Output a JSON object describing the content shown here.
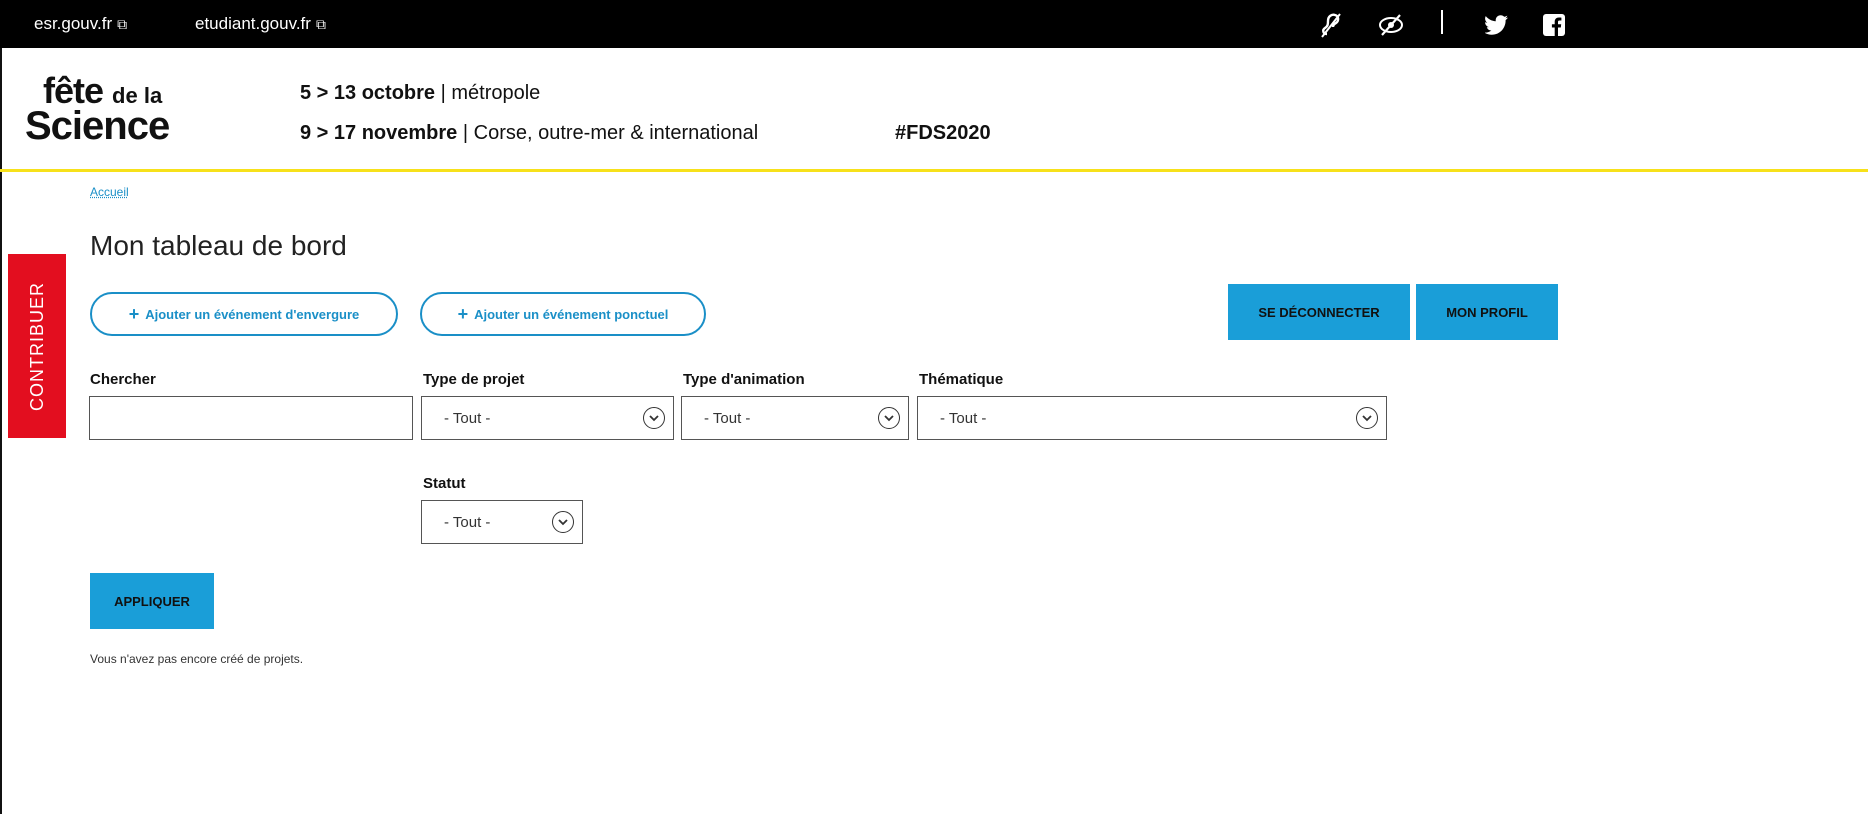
{
  "topbar": {
    "links": [
      "esr.gouv.fr",
      "etudiant.gouv.fr"
    ],
    "icons": [
      "hearing-assist-icon",
      "eye-slash-icon",
      "twitter-icon",
      "facebook-icon"
    ]
  },
  "header": {
    "logo_line1": "fête",
    "logo_line1_small": "de la",
    "logo_line2": "Science",
    "date1_bold": "5 > 13 octobre",
    "date1_rest": " | métropole",
    "date2_bold": "9 > 17 novembre",
    "date2_rest": " | Corse, outre-mer & international",
    "hashtag": "#FDS2020"
  },
  "breadcrumb": "Accueil",
  "page_title": "Mon tableau de bord",
  "side_tab": "CONTRIBUER",
  "actions": {
    "add_major": "Ajouter un événement d'envergure",
    "add_single": "Ajouter un événement ponctuel",
    "logout": "SE DÉCONNECTER",
    "profile": "MON PROFIL"
  },
  "filters": {
    "search_label": "Chercher",
    "search_value": "",
    "project_type_label": "Type de projet",
    "project_type_value": "- Tout -",
    "animation_type_label": "Type d'animation",
    "animation_type_value": "- Tout -",
    "theme_label": "Thématique",
    "theme_value": "- Tout -",
    "status_label": "Statut",
    "status_value": "- Tout -",
    "apply": "APPLIQUER"
  },
  "empty_message": "Vous n'avez pas encore créé de projets.",
  "colors": {
    "accent_blue": "#1a9ed8",
    "side_red": "#e30e1f",
    "header_yellow": "#f7e11a"
  }
}
